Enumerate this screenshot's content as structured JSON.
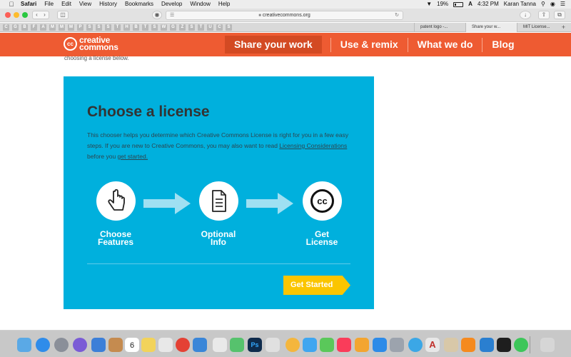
{
  "menubar": {
    "app_name": "Safari",
    "menus": [
      "File",
      "Edit",
      "View",
      "History",
      "Bookmarks",
      "Develop",
      "Window",
      "Help"
    ],
    "battery": "19%",
    "time": "4:32 PM",
    "user": "Karan Tanna"
  },
  "browser": {
    "url": "creativecommons.org",
    "tabs": [
      {
        "label": "patent logo -..."
      },
      {
        "label": "Share your w..."
      },
      {
        "label": "MIT License..."
      }
    ],
    "favorites": [
      "C",
      "G",
      "B",
      "F",
      "A",
      "M",
      "M",
      "M",
      "P",
      "S",
      "S",
      "S",
      "T",
      "H",
      "B",
      "T",
      "S",
      "W",
      "G",
      "Z",
      "S",
      "T",
      "U",
      "C",
      "S"
    ]
  },
  "site": {
    "logo_line1": "creative",
    "logo_line2": "commons",
    "logo_mark": "cc",
    "nav": [
      "Share your work",
      "Use & remix",
      "What we do",
      "Blog"
    ],
    "clipped_text": "choosing a license below."
  },
  "chooser": {
    "title": "Choose a license",
    "desc_part1": "This chooser helps you determine which Creative Commons License is right for you in a few easy steps. If you are new to Creative Commons, you may also want to read ",
    "desc_link1": "Licensing Considerations",
    "desc_part2": " before you ",
    "desc_link2": "get started.",
    "steps": [
      {
        "line1": "Choose",
        "line2": "Features",
        "icon": "pointing-hand-icon"
      },
      {
        "line1": "Optional",
        "line2": "Info",
        "icon": "document-icon"
      },
      {
        "line1": "Get",
        "line2": "License",
        "icon": "cc-icon"
      }
    ],
    "cta_label": "Get Started",
    "cc_glyph": "cc"
  },
  "colors": {
    "header": "#ee5b32",
    "card": "#00b0dd",
    "cta": "#fbc500"
  },
  "dock": {
    "calendar_day": "6"
  }
}
